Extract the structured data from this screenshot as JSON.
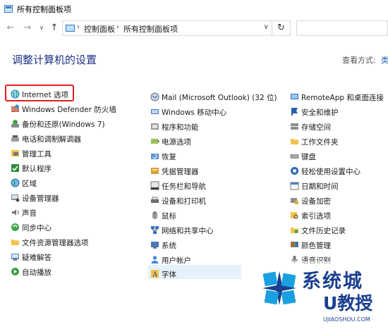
{
  "window": {
    "title": "所有控制面板项"
  },
  "address": {
    "crumbs": [
      "控制面板",
      "所有控制面板项"
    ]
  },
  "heading": "调整计算机的设置",
  "view_by": {
    "label": "查看方式:",
    "value": "类"
  },
  "items": [
    {
      "label": "Internet 选项",
      "icon": "globe-icon"
    },
    {
      "label": "Windows Defender 防火墙",
      "icon": "firewall-icon"
    },
    {
      "label": "备份和还原(Windows 7)",
      "icon": "backup-icon"
    },
    {
      "label": "电话和调制解调器",
      "icon": "phone-modem-icon"
    },
    {
      "label": "管理工具",
      "icon": "admin-tools-icon"
    },
    {
      "label": "默认程序",
      "icon": "default-programs-icon"
    },
    {
      "label": "区域",
      "icon": "region-icon"
    },
    {
      "label": "设备管理器",
      "icon": "device-manager-icon"
    },
    {
      "label": "声音",
      "icon": "sound-icon"
    },
    {
      "label": "同步中心",
      "icon": "sync-center-icon"
    },
    {
      "label": "文件资源管理器选项",
      "icon": "folder-options-icon"
    },
    {
      "label": "疑难解答",
      "icon": "troubleshooting-icon"
    },
    {
      "label": "自动播放",
      "icon": "autoplay-icon"
    },
    {
      "label": "Mail (Microsoft Outlook) (32 位)",
      "icon": "mail-icon"
    },
    {
      "label": "Windows 移动中心",
      "icon": "mobility-center-icon"
    },
    {
      "label": "程序和功能",
      "icon": "programs-features-icon"
    },
    {
      "label": "电源选项",
      "icon": "power-options-icon"
    },
    {
      "label": "恢复",
      "icon": "recovery-icon"
    },
    {
      "label": "凭据管理器",
      "icon": "credential-manager-icon"
    },
    {
      "label": "任务栏和导航",
      "icon": "taskbar-icon"
    },
    {
      "label": "设备和打印机",
      "icon": "printer-icon"
    },
    {
      "label": "鼠标",
      "icon": "mouse-icon"
    },
    {
      "label": "网络和共享中心",
      "icon": "network-icon"
    },
    {
      "label": "系统",
      "icon": "system-icon"
    },
    {
      "label": "用户帐户",
      "icon": "user-accounts-icon"
    },
    {
      "label": "字体",
      "icon": "fonts-icon"
    },
    {
      "label": "RemoteApp 和桌面连接",
      "icon": "remoteapp-icon"
    },
    {
      "label": "安全和维护",
      "icon": "security-maintenance-icon"
    },
    {
      "label": "存储空间",
      "icon": "storage-spaces-icon"
    },
    {
      "label": "工作文件夹",
      "icon": "work-folders-icon"
    },
    {
      "label": "键盘",
      "icon": "keyboard-icon"
    },
    {
      "label": "轻松使用设置中心",
      "icon": "ease-of-access-icon"
    },
    {
      "label": "日期和时间",
      "icon": "date-time-icon"
    },
    {
      "label": "设备加密",
      "icon": "device-encryption-icon"
    },
    {
      "label": "索引选项",
      "icon": "indexing-icon"
    },
    {
      "label": "文件历史记录",
      "icon": "file-history-icon"
    },
    {
      "label": "颜色管理",
      "icon": "color-management-icon"
    },
    {
      "label": "语音识别",
      "icon": "speech-recognition-icon"
    }
  ],
  "watermark": {
    "line1": "系统城",
    "line2": "U教授",
    "url": "UJIAOSHOU.COM"
  }
}
